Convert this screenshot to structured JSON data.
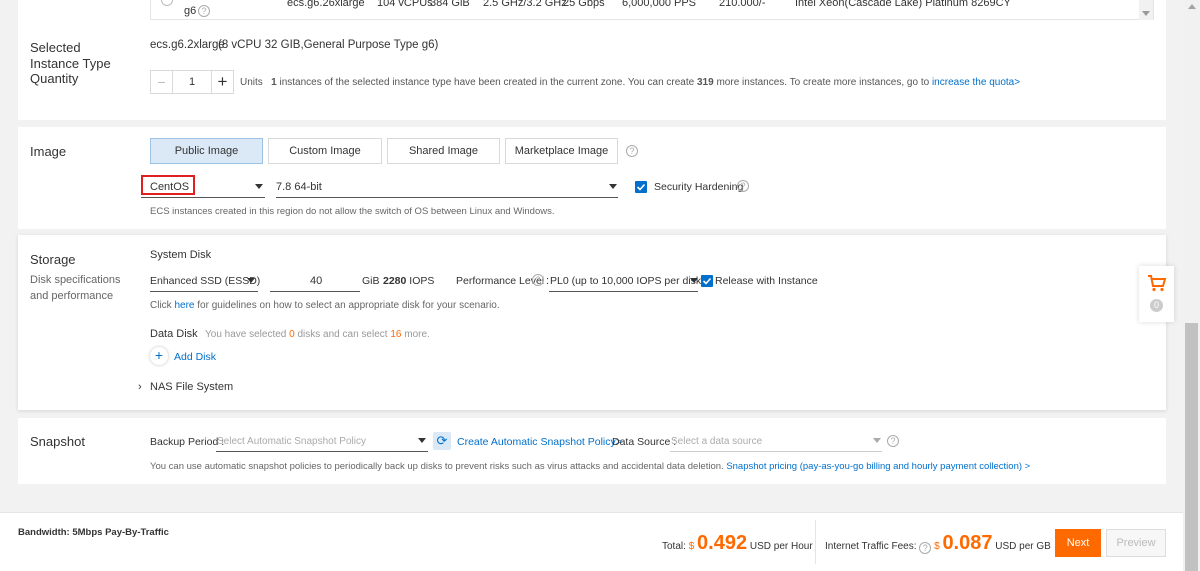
{
  "top_table": {
    "row": {
      "family": "g6",
      "instance_type": "ecs.g6.26xlarge",
      "vcpus": "104 vCPUs",
      "memory": "384 GiB",
      "clock": "2.5 GHz/3.2 GHz",
      "bandwidth": "25 Gbps",
      "pps": "6,000,000 PPS",
      "price": "210.000/-",
      "processor": "Intel Xeon(Cascade Lake) Platinum 8269CY"
    }
  },
  "selected_instance": {
    "label": "Selected Instance Type",
    "value_type": "ecs.g6.2xlarge",
    "value_spec": "(8 vCPU 32 GIB,General Purpose Type g6)"
  },
  "quantity": {
    "label": "Quantity",
    "minus": "−",
    "value": "1",
    "plus": "+",
    "units": "Units",
    "count": "1",
    "msg_a": "instances of the selected instance type have been created in the current zone. You can create",
    "remaining": "319",
    "msg_b": "more instances. To create more instances, go to",
    "quota_link": "increase the quota>"
  },
  "image": {
    "label": "Image",
    "tabs": [
      "Public Image",
      "Custom Image",
      "Shared Image",
      "Marketplace Image"
    ],
    "os": "CentOS",
    "version": "7.8 64-bit",
    "hardening": "Security Hardening",
    "note": "ECS instances created in this region do not allow the switch of OS between Linux and Windows."
  },
  "storage": {
    "label": "Storage",
    "sublabel": "Disk specifications and performance",
    "system_disk": "System Disk",
    "disk_type": "Enhanced SSD (ESSD)",
    "size": "40",
    "unit": "GiB",
    "iops": "2280",
    "iops_unit": "IOPS",
    "perf_label": "Performance Level",
    "perf_colon": ":",
    "perf_value": "PL0 (up to 10,000 IOPS per disk)",
    "release": "Release with Instance",
    "guide_a": "Click",
    "guide_link": "here",
    "guide_b": "for guidelines on how to select an appropriate disk for your scenario.",
    "data_disk": "Data Disk",
    "data_a": "You have selected",
    "data_selected": "0",
    "data_b": "disks and can select",
    "data_more": "16",
    "data_c": "more.",
    "add_disk": "Add Disk",
    "nas": "NAS File System"
  },
  "cart": {
    "count": "0"
  },
  "snapshot": {
    "label": "Snapshot",
    "backup_label": "Backup Period :",
    "backup_placeholder": "Select Automatic Snapshot Policy",
    "create_link": "Create Automatic Snapshot Policy>",
    "source_label": "Data Source :",
    "source_placeholder": "Select a data source",
    "note": "You can use automatic snapshot policies to periodically back up disks to prevent risks such as virus attacks and accidental data deletion.",
    "pricing_link": "Snapshot pricing (pay-as-you-go billing and hourly payment collection) >"
  },
  "footer": {
    "bandwidth": "Bandwidth: 5Mbps Pay-By-Traffic",
    "total_label": "Total:",
    "currency": "$",
    "total_value": "0.492",
    "total_unit": "USD per Hour",
    "traffic_label": "Internet Traffic Fees:",
    "traffic_value": "0.087",
    "traffic_unit": "USD per GB",
    "next": "Next",
    "preview": "Preview"
  },
  "colors": {
    "accent": "#ff6a00",
    "link": "#0070cc",
    "highlight_box": "#e02020"
  }
}
